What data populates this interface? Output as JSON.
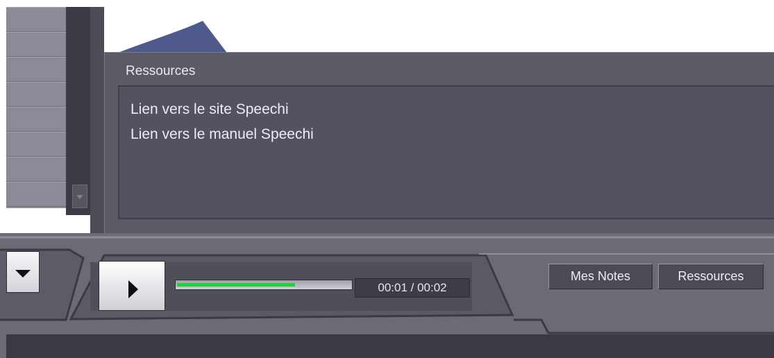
{
  "panel": {
    "title": "Ressources",
    "links": [
      "Lien vers le site Speechi",
      "Lien vers le manuel Speechi"
    ]
  },
  "player": {
    "time": "00:01 / 00:02",
    "progress_fraction": 0.68,
    "play_icon": "play-icon"
  },
  "buttons": {
    "notes": "Mes Notes",
    "resources": "Ressources"
  },
  "colors": {
    "panel_bg": "#5b5b66",
    "progress_green": "#23d13a",
    "chrome_gray": "#6b6b76",
    "slide_accent": "#4f5a8c"
  }
}
